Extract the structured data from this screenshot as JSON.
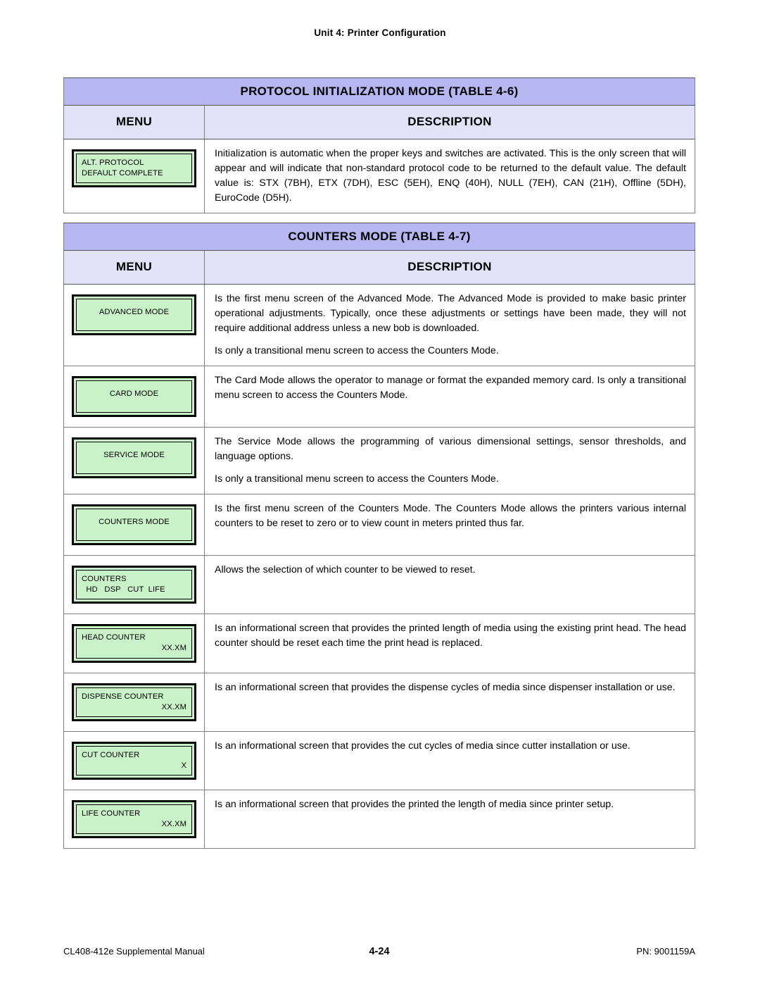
{
  "header": {
    "running_head": "Unit 4:  Printer Configuration"
  },
  "tables": [
    {
      "title": "PROTOCOL INITIALIZATION MODE (TABLE 4-6)",
      "col_menu": "MENU",
      "col_description": "DESCRIPTION",
      "rows": [
        {
          "lcd_lines": [
            "ALT. PROTOCOL",
            "DEFAULT COMPLETE"
          ],
          "paragraphs": [
            "Initialization is automatic when the proper keys and switches are activated. This is the only screen that will appear and will indicate that non-standard protocol code to be returned to the default value. The default value is: STX (7BH), ETX (7DH), ESC (5EH), ENQ (40H), NULL (7EH), CAN (21H), Offline (5DH), EuroCode (D5H)."
          ]
        }
      ]
    },
    {
      "title": "COUNTERS MODE (TABLE 4-7)",
      "col_menu": "MENU",
      "col_description": "DESCRIPTION",
      "rows": [
        {
          "lcd_lines": [
            "ADVANCED MODE"
          ],
          "lcd_align": "center",
          "lcd_size": "tall",
          "paragraphs": [
            "Is the first menu screen of the Advanced Mode. The Advanced Mode is provided to make basic printer operational adjustments. Typically, once these adjustments or settings have been made, they will not require additional address unless a new bob is downloaded.",
            "Is only a transitional menu screen to access the Counters Mode."
          ]
        },
        {
          "lcd_lines": [
            "CARD MODE"
          ],
          "lcd_align": "center",
          "lcd_size": "tall",
          "paragraphs": [
            "The Card Mode allows the operator to manage or format the expanded memory card. Is only a transitional menu screen to access the Counters Mode."
          ]
        },
        {
          "lcd_lines": [
            "SERVICE MODE"
          ],
          "lcd_align": "center",
          "lcd_size": "tall",
          "paragraphs": [
            "The Service Mode allows the programming of various dimensional settings, sensor thresholds, and language options.",
            "Is only a transitional menu screen to access the Counters Mode."
          ]
        },
        {
          "lcd_lines": [
            "COUNTERS MODE"
          ],
          "lcd_align": "center",
          "lcd_size": "tall",
          "paragraphs": [
            "Is the first menu screen of the Counters Mode. The Counters Mode allows the printers various internal counters to be reset to zero or to view count in meters printed thus far."
          ]
        },
        {
          "lcd_lines": [
            "COUNTERS",
            "  HD   DSP   CUT  LIFE"
          ],
          "paragraphs": [
            "Allows the selection of which counter to be viewed to reset."
          ]
        },
        {
          "lcd_lines": [
            "HEAD COUNTER"
          ],
          "lcd_value": "XX.XM",
          "paragraphs": [
            "Is an informational screen that provides the printed length of media using the existing print head. The head counter should be reset each time the print head is replaced."
          ]
        },
        {
          "lcd_lines": [
            "DISPENSE COUNTER"
          ],
          "lcd_value": "XX.XM",
          "paragraphs": [
            "Is an informational screen that provides the dispense cycles of media since dispenser installation or use."
          ]
        },
        {
          "lcd_lines": [
            "CUT COUNTER"
          ],
          "lcd_value": "X",
          "paragraphs": [
            "Is an informational screen that provides the cut cycles of media since cutter installation or use."
          ]
        },
        {
          "lcd_lines": [
            "LIFE COUNTER"
          ],
          "lcd_value": "XX.XM",
          "paragraphs": [
            "Is an informational screen that provides the printed the length of media since printer setup."
          ]
        }
      ]
    }
  ],
  "footer": {
    "left": "CL408-412e Supplemental Manual",
    "page_number": "4-24",
    "right": "PN: 9001159A"
  },
  "colors": {
    "title_row_bg": "#b6b6f0",
    "subhead_row_bg": "#e2e2f8",
    "lcd_screen_bg": "#c9f2c9",
    "page_bg": "#ffffff",
    "text": "#000000",
    "table_border": "#808080"
  }
}
